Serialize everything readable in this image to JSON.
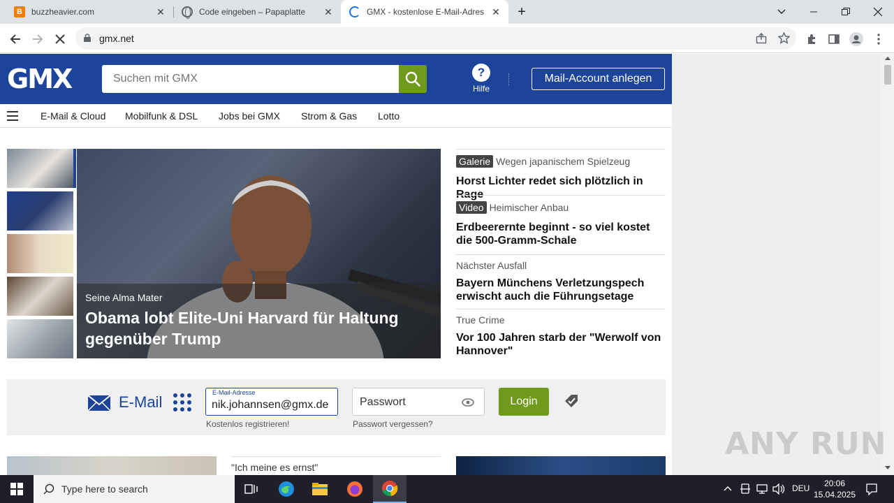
{
  "browser": {
    "tabs": [
      {
        "title": "buzzheavier.com",
        "favicon": "b-favicon"
      },
      {
        "title": "Code eingeben – Papaplatte",
        "favicon": "globe-icon"
      },
      {
        "title": "GMX - kostenlose E-Mail-Adresse",
        "favicon": "loading-spinner"
      }
    ],
    "new_tab": "+",
    "url": "gmx.net"
  },
  "header": {
    "logo": "GMX",
    "search_placeholder": "Suchen mit GMX",
    "help_label": "Hilfe",
    "mail_account_button": "Mail-Account anlegen"
  },
  "nav": {
    "items": [
      "E-Mail & Cloud",
      "Mobilfunk & DSL",
      "Jobs bei GMX",
      "Strom & Gas",
      "Lotto"
    ]
  },
  "hero": {
    "kicker": "Seine Alma Mater",
    "title": "Obama lobt Elite-Uni Harvard für Haltung gegenüber Trump"
  },
  "news": [
    {
      "badge": "Galerie",
      "kicker": "Wegen japanischem Spielzeug",
      "headline": "Horst Lichter redet sich plötzlich in Rage"
    },
    {
      "badge": "Video",
      "kicker": "Heimischer Anbau",
      "headline": "Erdbeerernte beginnt - so viel kostet die 500-Gramm-Schale"
    },
    {
      "badge": "",
      "kicker": "Nächster Ausfall",
      "headline": "Bayern Münchens Verletzungspech erwischt auch die Führungsetage"
    },
    {
      "badge": "",
      "kicker": "True Crime",
      "headline": "Vor 100 Jahren starb der \"Werwolf von Hannover\""
    }
  ],
  "login": {
    "section_label": "E-Mail",
    "email_label": "E-Mail-Adresse",
    "email_value": "nik.johannsen@gmx.de",
    "password_placeholder": "Passwort",
    "login_button": "Login",
    "register_link": "Kostenlos registrieren!",
    "forgot_link": "Passwort vergessen?"
  },
  "teasers": {
    "quote": "\"Ich meine es ernst\""
  },
  "watermark": "ANY RUN",
  "taskbar": {
    "search_placeholder": "Type here to search",
    "language": "DEU",
    "time": "20:06",
    "date": "15.04.2025"
  },
  "colors": {
    "gmx_blue": "#1c449b",
    "gmx_green": "#6f9a1b"
  }
}
